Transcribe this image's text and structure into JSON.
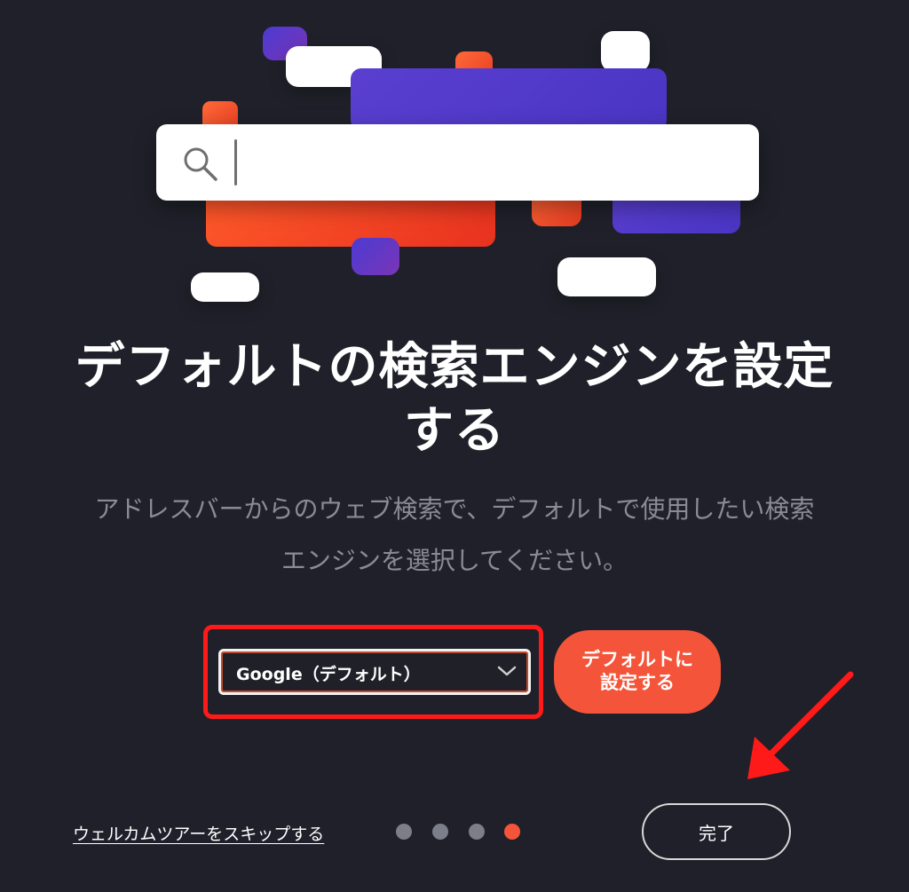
{
  "illustration": {
    "search_icon": "search-icon"
  },
  "title": {
    "line1": "デフォルトの検索エンジンを設定",
    "line2": "する"
  },
  "description": {
    "line1": "アドレスバーからのウェブ検索で、デフォルトで使用したい検索",
    "line2": "エンジンを選択してください。"
  },
  "search_engine_select": {
    "selected": "Google（デフォルト）",
    "icon": "chevron-down-icon"
  },
  "set_default_button": {
    "line1": "デフォルトに",
    "line2": "設定する"
  },
  "footer": {
    "skip_link": "ウェルカムツアーをスキップする",
    "done_button": "完了",
    "pagination": {
      "total": 4,
      "current": 4
    }
  },
  "colors": {
    "background": "#1f2029",
    "accent": "#f4553a",
    "annotation_red": "#ff1a1a",
    "purple": "#4a35c4"
  }
}
